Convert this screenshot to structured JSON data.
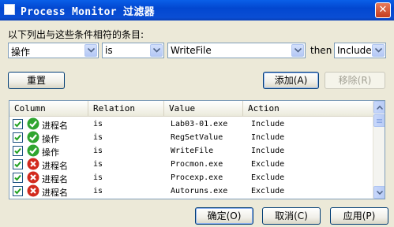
{
  "window": {
    "title": "Process Monitor 过滤器",
    "close_glyph": "✕"
  },
  "prompt": "以下列出与这些条件相符的条目:",
  "filter": {
    "column_value": "操作",
    "relation_value": "is",
    "value_value": "WriteFile",
    "then_label": "then",
    "action_value": "Include"
  },
  "buttons": {
    "reset": "重置",
    "add": "添加(A)",
    "remove": "移除(R)",
    "ok": "确定(O)",
    "cancel": "取消(C)",
    "apply": "应用(P)"
  },
  "list": {
    "headers": {
      "column": "Column",
      "relation": "Relation",
      "value": "Value",
      "action": "Action"
    },
    "rows": [
      {
        "column": "进程名",
        "relation": "is",
        "value": "Lab03-01.exe",
        "action": "Include",
        "status": "include-icon",
        "checked": true
      },
      {
        "column": "操作",
        "relation": "is",
        "value": "RegSetValue",
        "action": "Include",
        "status": "include-icon",
        "checked": true
      },
      {
        "column": "操作",
        "relation": "is",
        "value": "WriteFile",
        "action": "Include",
        "status": "include-icon",
        "checked": true
      },
      {
        "column": "进程名",
        "relation": "is",
        "value": "Procmon.exe",
        "action": "Exclude",
        "status": "exclude-icon",
        "checked": true
      },
      {
        "column": "进程名",
        "relation": "is",
        "value": "Procexp.exe",
        "action": "Exclude",
        "status": "exclude-icon",
        "checked": true
      },
      {
        "column": "进程名",
        "relation": "is",
        "value": "Autoruns.exe",
        "action": "Exclude",
        "status": "exclude-icon",
        "checked": true
      }
    ]
  },
  "colors": {
    "include": "#2fa52f",
    "exclude": "#d22a1e",
    "titlebar": "#0a4ed4",
    "dialog": "#ece9d8"
  }
}
